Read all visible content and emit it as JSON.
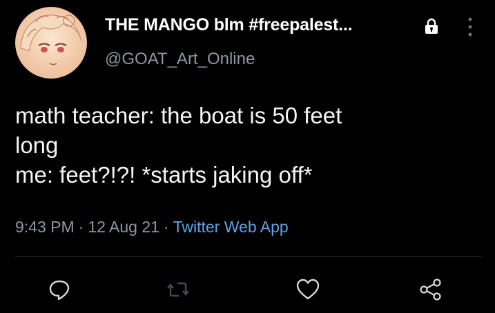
{
  "tweet": {
    "display_name": "THE MANGO blm #freepalest...",
    "handle": "@GOAT_Art_Online",
    "text_lines": [
      "math teacher: the boat is 50 feet",
      "long",
      "me: feet?!?! *starts jaking off*"
    ],
    "time": "9:43 PM",
    "date": "12 Aug 21",
    "source": "Twitter Web App",
    "separator": "·"
  },
  "icons": {
    "lock": "lock-icon",
    "more": "more-vertical-icon",
    "reply": "reply-icon",
    "retweet": "retweet-icon",
    "like": "heart-icon",
    "share": "share-icon"
  },
  "colors": {
    "background": "#000000",
    "text": "#f5f5f5",
    "secondary": "#8b98a5",
    "link": "#5ea4e6"
  }
}
